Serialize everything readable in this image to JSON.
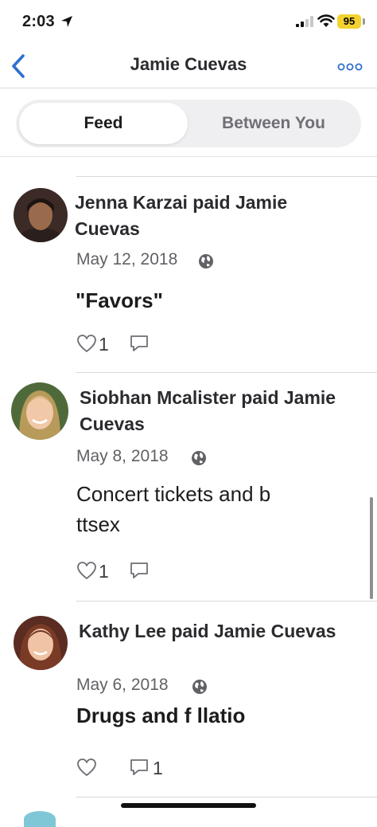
{
  "status_bar": {
    "time": "2:03",
    "battery": "95"
  },
  "nav": {
    "title": "Jamie Cuevas"
  },
  "tabs": {
    "feed": "Feed",
    "between": "Between You"
  },
  "feed": [
    {
      "title": "Jenna Karzai paid Jamie Cuevas",
      "date": "May 12, 2018",
      "note": "\"Favors\"",
      "likes": "1",
      "comments": ""
    },
    {
      "title": "Siobhan Mcalister paid Jamie Cuevas",
      "date": "May 8, 2018",
      "note": "Concert tickets and b  ttsex",
      "likes": "1",
      "comments": ""
    },
    {
      "title": "Kathy Lee paid Jamie Cuevas",
      "date": "May 6, 2018",
      "note": "Drugs and f  llatio",
      "likes": "",
      "comments": "1"
    }
  ],
  "colors": {
    "accent": "#2f6fd0",
    "battery": "#f2d22e",
    "text": "#1c1c1e",
    "muted": "#616166"
  }
}
